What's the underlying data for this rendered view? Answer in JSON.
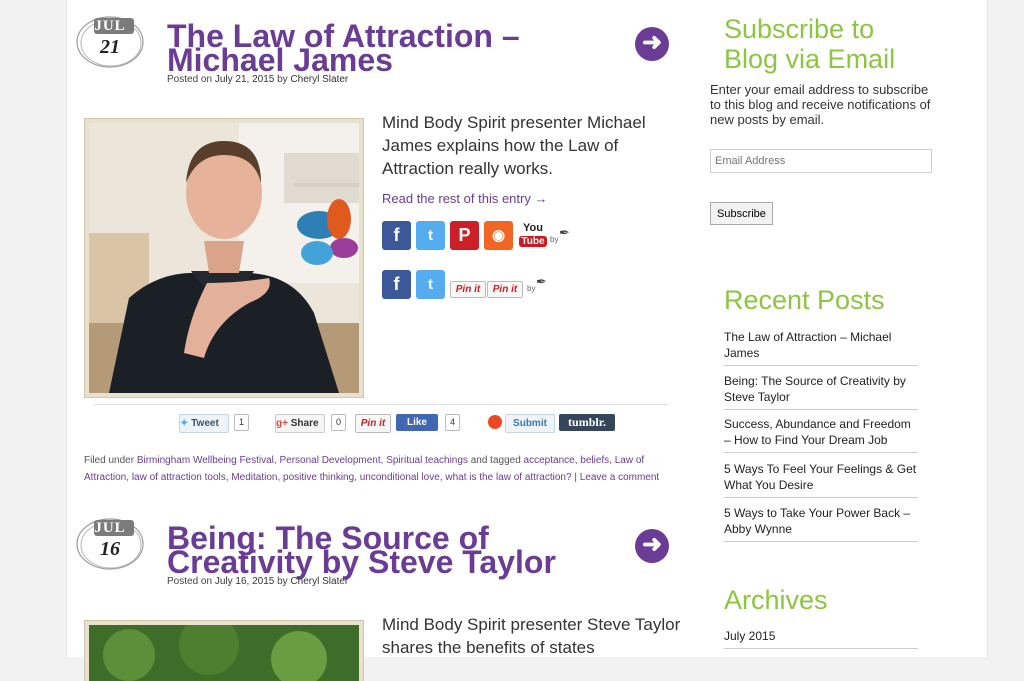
{
  "posts": [
    {
      "month": "JUL",
      "day": "21",
      "title_line1": "The Law of Attraction –",
      "title_line2": "Michael James",
      "meta_prefix": "Posted on",
      "date": "July 21, 2015",
      "meta_by": "by",
      "author": "Cheryl Slater",
      "excerpt": "Mind Body Spirit presenter Michael James explains how the Law of Attraction really works.",
      "read_more": "Read the rest of this entry →"
    },
    {
      "month": "JUL",
      "day": "16",
      "title_line1": "Being: The Source of",
      "title_line2": "Creativity by Steve Taylor",
      "meta_prefix": "Posted on",
      "date": "July 16, 2015",
      "meta_by": "by",
      "author": "Cheryl Slater",
      "excerpt": "Mind Body Spirit presenter Steve Taylor shares the benefits of states"
    }
  ],
  "social": {
    "by": "by",
    "pinit": "Pin it",
    "youtube": "You",
    "youtube_sub": "Tube"
  },
  "share_bar": {
    "tweet": "Tweet",
    "tweet_count": "1",
    "gplus": "g+",
    "gplus_label": "Share",
    "gplus_count": "0",
    "pinit": "Pin it",
    "fb_like": "Like",
    "fb_count": "4",
    "stumble": "Submit",
    "tumblr": "tumblr."
  },
  "filed": {
    "filed_under": "Filed under",
    "categories": [
      "Birmingham Wellbeing Festival",
      "Personal Development",
      "Spiritual teachings"
    ],
    "tagged": "and tagged",
    "tags": [
      "acceptance",
      "beliefs",
      "Law of Attraction",
      "law of attraction tools",
      "Meditation",
      "positive thinking",
      "unconditional love",
      "what is the law of attraction?"
    ],
    "separator": "|",
    "comment": "Leave a comment"
  },
  "sidebar": {
    "subscribe_title_line1": "Subscribe to",
    "subscribe_title_line2": "Blog via Email",
    "subscribe_text": "Enter your email address to subscribe to this blog and receive notifications of new posts by email.",
    "email_placeholder": "Email Address",
    "subscribe_button": "Subscribe",
    "recent_title": "Recent Posts",
    "recent_posts": [
      "The Law of Attraction – Michael James",
      "Being: The Source of Creativity by Steve Taylor",
      "Success, Abundance and Freedom – How to Find Your Dream Job",
      "5 Ways To Feel Your Feelings & Get What You Desire",
      "5 Ways to Take Your Power Back – Abby Wynne"
    ],
    "archives_title": "Archives",
    "archives": [
      "July 2015"
    ]
  },
  "colors": {
    "title_purple": "#6a3c96",
    "widget_green": "#8cc63f",
    "facebook": "#3b5998",
    "twitter": "#55acee",
    "pinterest": "#cb2027",
    "rss": "#f26522"
  },
  "icons": [
    "date-badge-icon",
    "arrow-right-icon",
    "facebook-icon",
    "twitter-icon",
    "pinterest-icon",
    "rss-icon",
    "youtube-icon",
    "feather-icon",
    "stumbleupon-icon"
  ]
}
